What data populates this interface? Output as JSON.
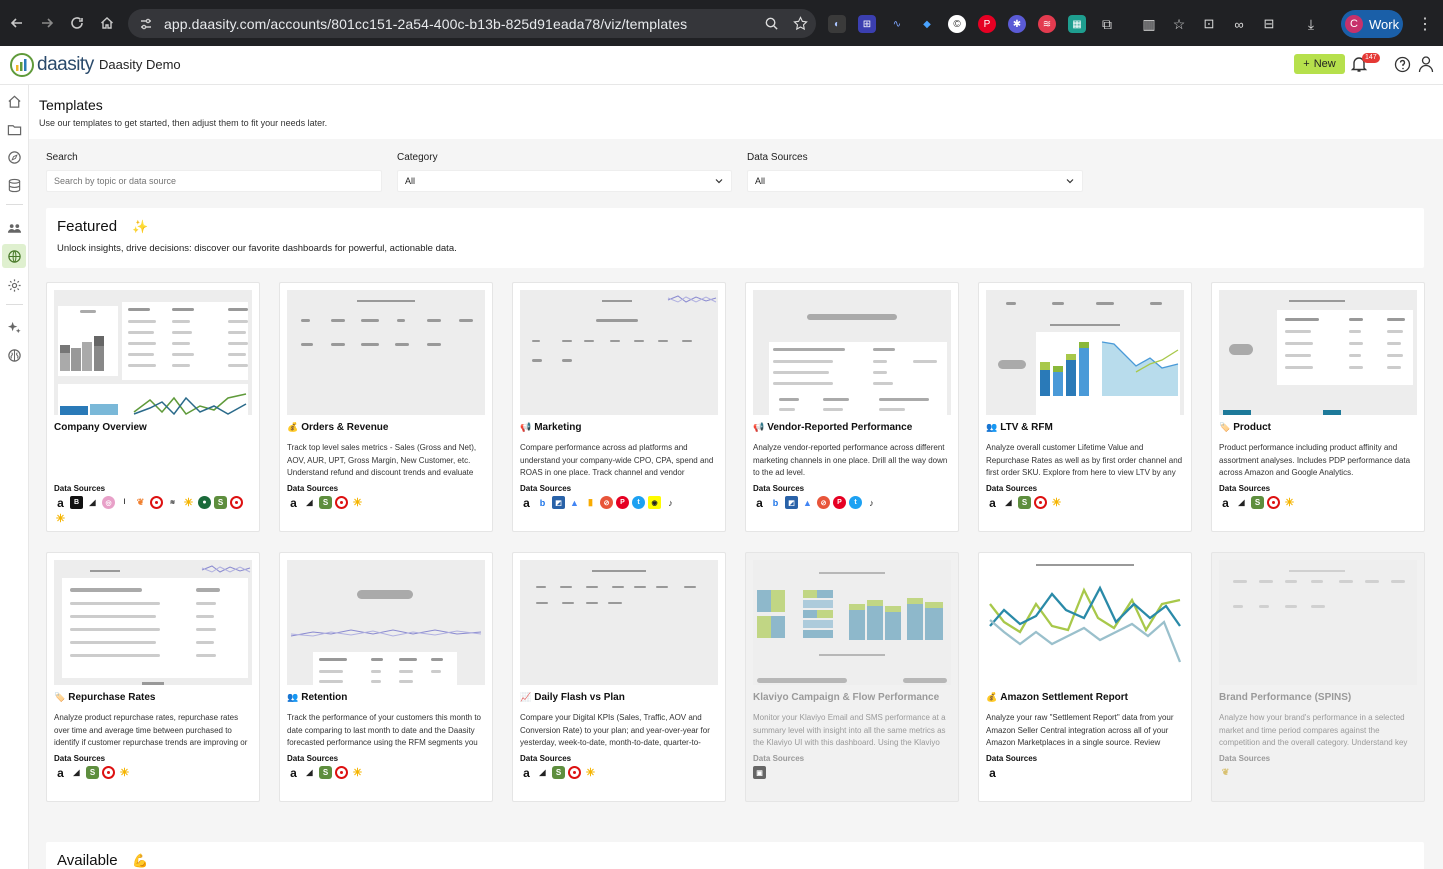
{
  "browser": {
    "url": "app.daasity.com/accounts/801cc151-2a54-400c-b13b-825d91eada78/viz/templates",
    "profile_initial": "C",
    "profile_name": "Work"
  },
  "header": {
    "logo_text": "daasity",
    "org_name": "Daasity Demo",
    "new_button": "New",
    "notification_count": "147"
  },
  "page": {
    "title": "Templates",
    "subtitle": "Use our templates to get started, then adjust them to fit your needs later."
  },
  "filters": {
    "search_label": "Search",
    "search_placeholder": "Search by topic or data source",
    "category_label": "Category",
    "category_value": "All",
    "datasources_label": "Data Sources",
    "datasources_value": "All"
  },
  "featured": {
    "title": "Featured",
    "emoji": "✨",
    "subtitle": "Unlock insights, drive decisions: discover our favorite dashboards for powerful, actionable data.",
    "data_sources_label": "Data Sources",
    "cards": [
      {
        "icon": "",
        "title": "Company Overview",
        "description": "",
        "disabled": false
      },
      {
        "icon": "💰",
        "title": "Orders & Revenue",
        "description": "Track top level sales metrics - Sales (Gross and Net), AOV, AUR, UPT, Gross Margin, New Customer, etc. Understand refund and discount trends and evaluate",
        "disabled": false
      },
      {
        "icon": "📢",
        "title": "Marketing",
        "description": "Compare performance across ad platforms and understand your company-wide CPO, CPA, spend and ROAS in one place. Track channel and vendor",
        "disabled": false
      },
      {
        "icon": "📢",
        "title": "Vendor-Reported Performance",
        "description": "Analyze vendor-reported performance across different marketing channels in one place. Drill all the way down to the ad level.",
        "disabled": false
      },
      {
        "icon": "👥",
        "title": "LTV & RFM",
        "description": "Analyze overall customer Lifetime Value and Repurchase Rates as well as by first order channel and first order SKU. Explore from here to view LTV by any",
        "disabled": false
      },
      {
        "icon": "🏷️",
        "title": "Product",
        "description": "Product performance including product affinity and assortment analyses. Includes PDP performance data across Amazon and Google Analytics.",
        "disabled": false
      },
      {
        "icon": "🏷️",
        "title": "Repurchase Rates",
        "description": "Analyze product repurchase rates, repurchase rates over time and average time between purchased to identify if customer repurchase trends are improving or",
        "disabled": false
      },
      {
        "icon": "👥",
        "title": "Retention",
        "description": "Track the performance of your customers this month to date comparing to last month to date and the Daasity forecasted performance using the RFM segments you",
        "disabled": false
      },
      {
        "icon": "📈",
        "title": "Daily Flash vs Plan",
        "description": "Compare your Digital KPIs (Sales, Traffic, AOV and Conversion Rate) to your plan; and year-over-year for yesterday, week-to-date, month-to-date, quarter-to-",
        "disabled": false
      },
      {
        "icon": "",
        "title": "Klaviyo Campaign & Flow Performance",
        "description": "Monitor your Klaviyo Email and SMS performance at a summary level with insight into all the same metrics as the Klaviyo UI with this dashboard. Using the Klaviyo",
        "disabled": true
      },
      {
        "icon": "💰",
        "title": "Amazon Settlement Report",
        "description": "Analyze your raw \"Settlement Report\" data from your Amazon Seller Central integration across all of your Amazon Marketplaces in a single source. Review",
        "disabled": false
      },
      {
        "icon": "",
        "title": "Brand Performance (SPINS)",
        "description": "Analyze how your brand's performance in a selected market and time period compares against the competition and the overall category. Understand key",
        "disabled": true
      }
    ]
  },
  "available": {
    "title": "Available",
    "emoji": "💪"
  }
}
